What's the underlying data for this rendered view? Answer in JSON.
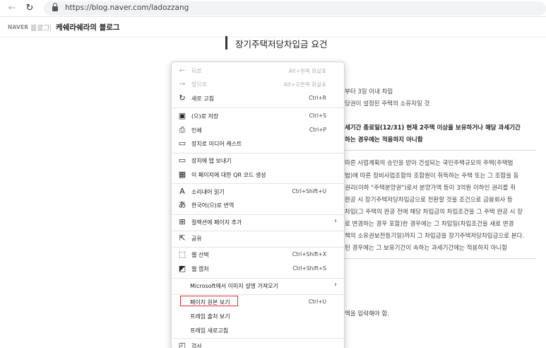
{
  "browser": {
    "url": "https://blog.naver.com/ladozzang"
  },
  "blog_header": {
    "brand": "NAVER",
    "blog_word": "블로그",
    "blog_name": "케쉐라쉐라의 블로그"
  },
  "article": {
    "title": "장기주택저당차입금 요건",
    "lines": [
      "부터 3일 이내 차입",
      "당권이 설정된 주택의 소유자일 것",
      "세기간 종료일(12/31) 현재 2주택 이상을 보유하거나 해당 과세기간",
      "하는 경우에는 적용하지 아니함",
      "따른 사업계획의 승인을 받아 건설되는 국민주택규모의 주택(주택법",
      "법)에 따른 정비사업조합의 조합원이 취득하는 주택 또는 그 조합을 동",
      "권리(이하 \"주택분양권\")로서 분양가액 등이 3억원 이하인 권리를 취",
      "완공 시 장기주택저당차입금으로 전환할 것을 조건으로 금융회사 등",
      "차입(그 주택의 완공 전에 해당 차입금의 차입조건을 그 주택 완공 시 장",
      "로 변경하는 경우 포함)한 경우에는 그 차입일(차입조건을 새로 변경",
      "책의 소유권보전등기일)까지 그 차입금을 장기주택저당차입금으로 본다.",
      "된 경우에는 그 보유기간이 속하는 과세기간에는 적용하지 아니함",
      "액을 입력해야 함."
    ]
  },
  "context_menu": {
    "items": [
      {
        "icon": "back-arrow-icon",
        "label": "뒤로",
        "shortcut": "Alt+왼쪽 화살표",
        "disabled": true
      },
      {
        "icon": "forward-arrow-icon",
        "label": "앞으로",
        "shortcut": "Alt+오른쪽 화살표",
        "disabled": true
      },
      {
        "icon": "refresh-icon",
        "label": "새로 고침",
        "shortcut": "Ctrl+R"
      },
      {
        "icon": "save-as-icon",
        "label": "(으)로 저장",
        "shortcut": "Ctrl+S"
      },
      {
        "icon": "print-icon",
        "label": "인쇄",
        "shortcut": "Ctrl+P"
      },
      {
        "icon": "cast-icon",
        "label": "장치로 미디어 캐스트",
        "shortcut": ""
      },
      {
        "icon": "send-to-device-icon",
        "label": "장치에 탭 보내기",
        "shortcut": ""
      },
      {
        "icon": "qr-code-icon",
        "label": "이 페이지에 대한 QR 코드 생성",
        "shortcut": ""
      },
      {
        "icon": "read-aloud-icon",
        "label": "소리내어 읽기",
        "shortcut": "Ctrl+Shift+U"
      },
      {
        "icon": "translate-icon",
        "label": "한국어(으)로 번역",
        "shortcut": ""
      },
      {
        "icon": "collections-icon",
        "label": "컬렉션에 페이지 추가",
        "shortcut": ""
      },
      {
        "icon": "share-icon",
        "label": "공유",
        "shortcut": ""
      },
      {
        "icon": "web-select-icon",
        "label": "웹 선택",
        "shortcut": "Ctrl+Shift+X"
      },
      {
        "icon": "web-capture-icon",
        "label": "웹 캡처",
        "shortcut": "Ctrl+Shift+S"
      },
      {
        "icon": "",
        "label": "Microsoft에서 이미지 설명 가져오기",
        "shortcut": ""
      },
      {
        "icon": "",
        "label": "페이지 원본 보기",
        "shortcut": "Ctrl+U"
      },
      {
        "icon": "",
        "label": "프레임 출처 보기",
        "shortcut": ""
      },
      {
        "icon": "",
        "label": "프레임 새로고침",
        "shortcut": ""
      },
      {
        "icon": "inspect-icon",
        "label": "검사",
        "shortcut": ""
      }
    ]
  },
  "glyphs": {
    "back": "←",
    "forward": "→",
    "refresh": "↻",
    "nav_back": "←",
    "nav_refresh": "↻",
    "save": "▣",
    "print": "⎙",
    "cast": "▭",
    "send": "▭",
    "qr": "▦",
    "read": "A",
    "translate": "あ",
    "collections": "⊞",
    "share": "⇱",
    "select": "⬚",
    "capture": "◩",
    "inspect": "◰",
    "chevron": "›"
  },
  "colors": {
    "highlight": "#e03030"
  }
}
